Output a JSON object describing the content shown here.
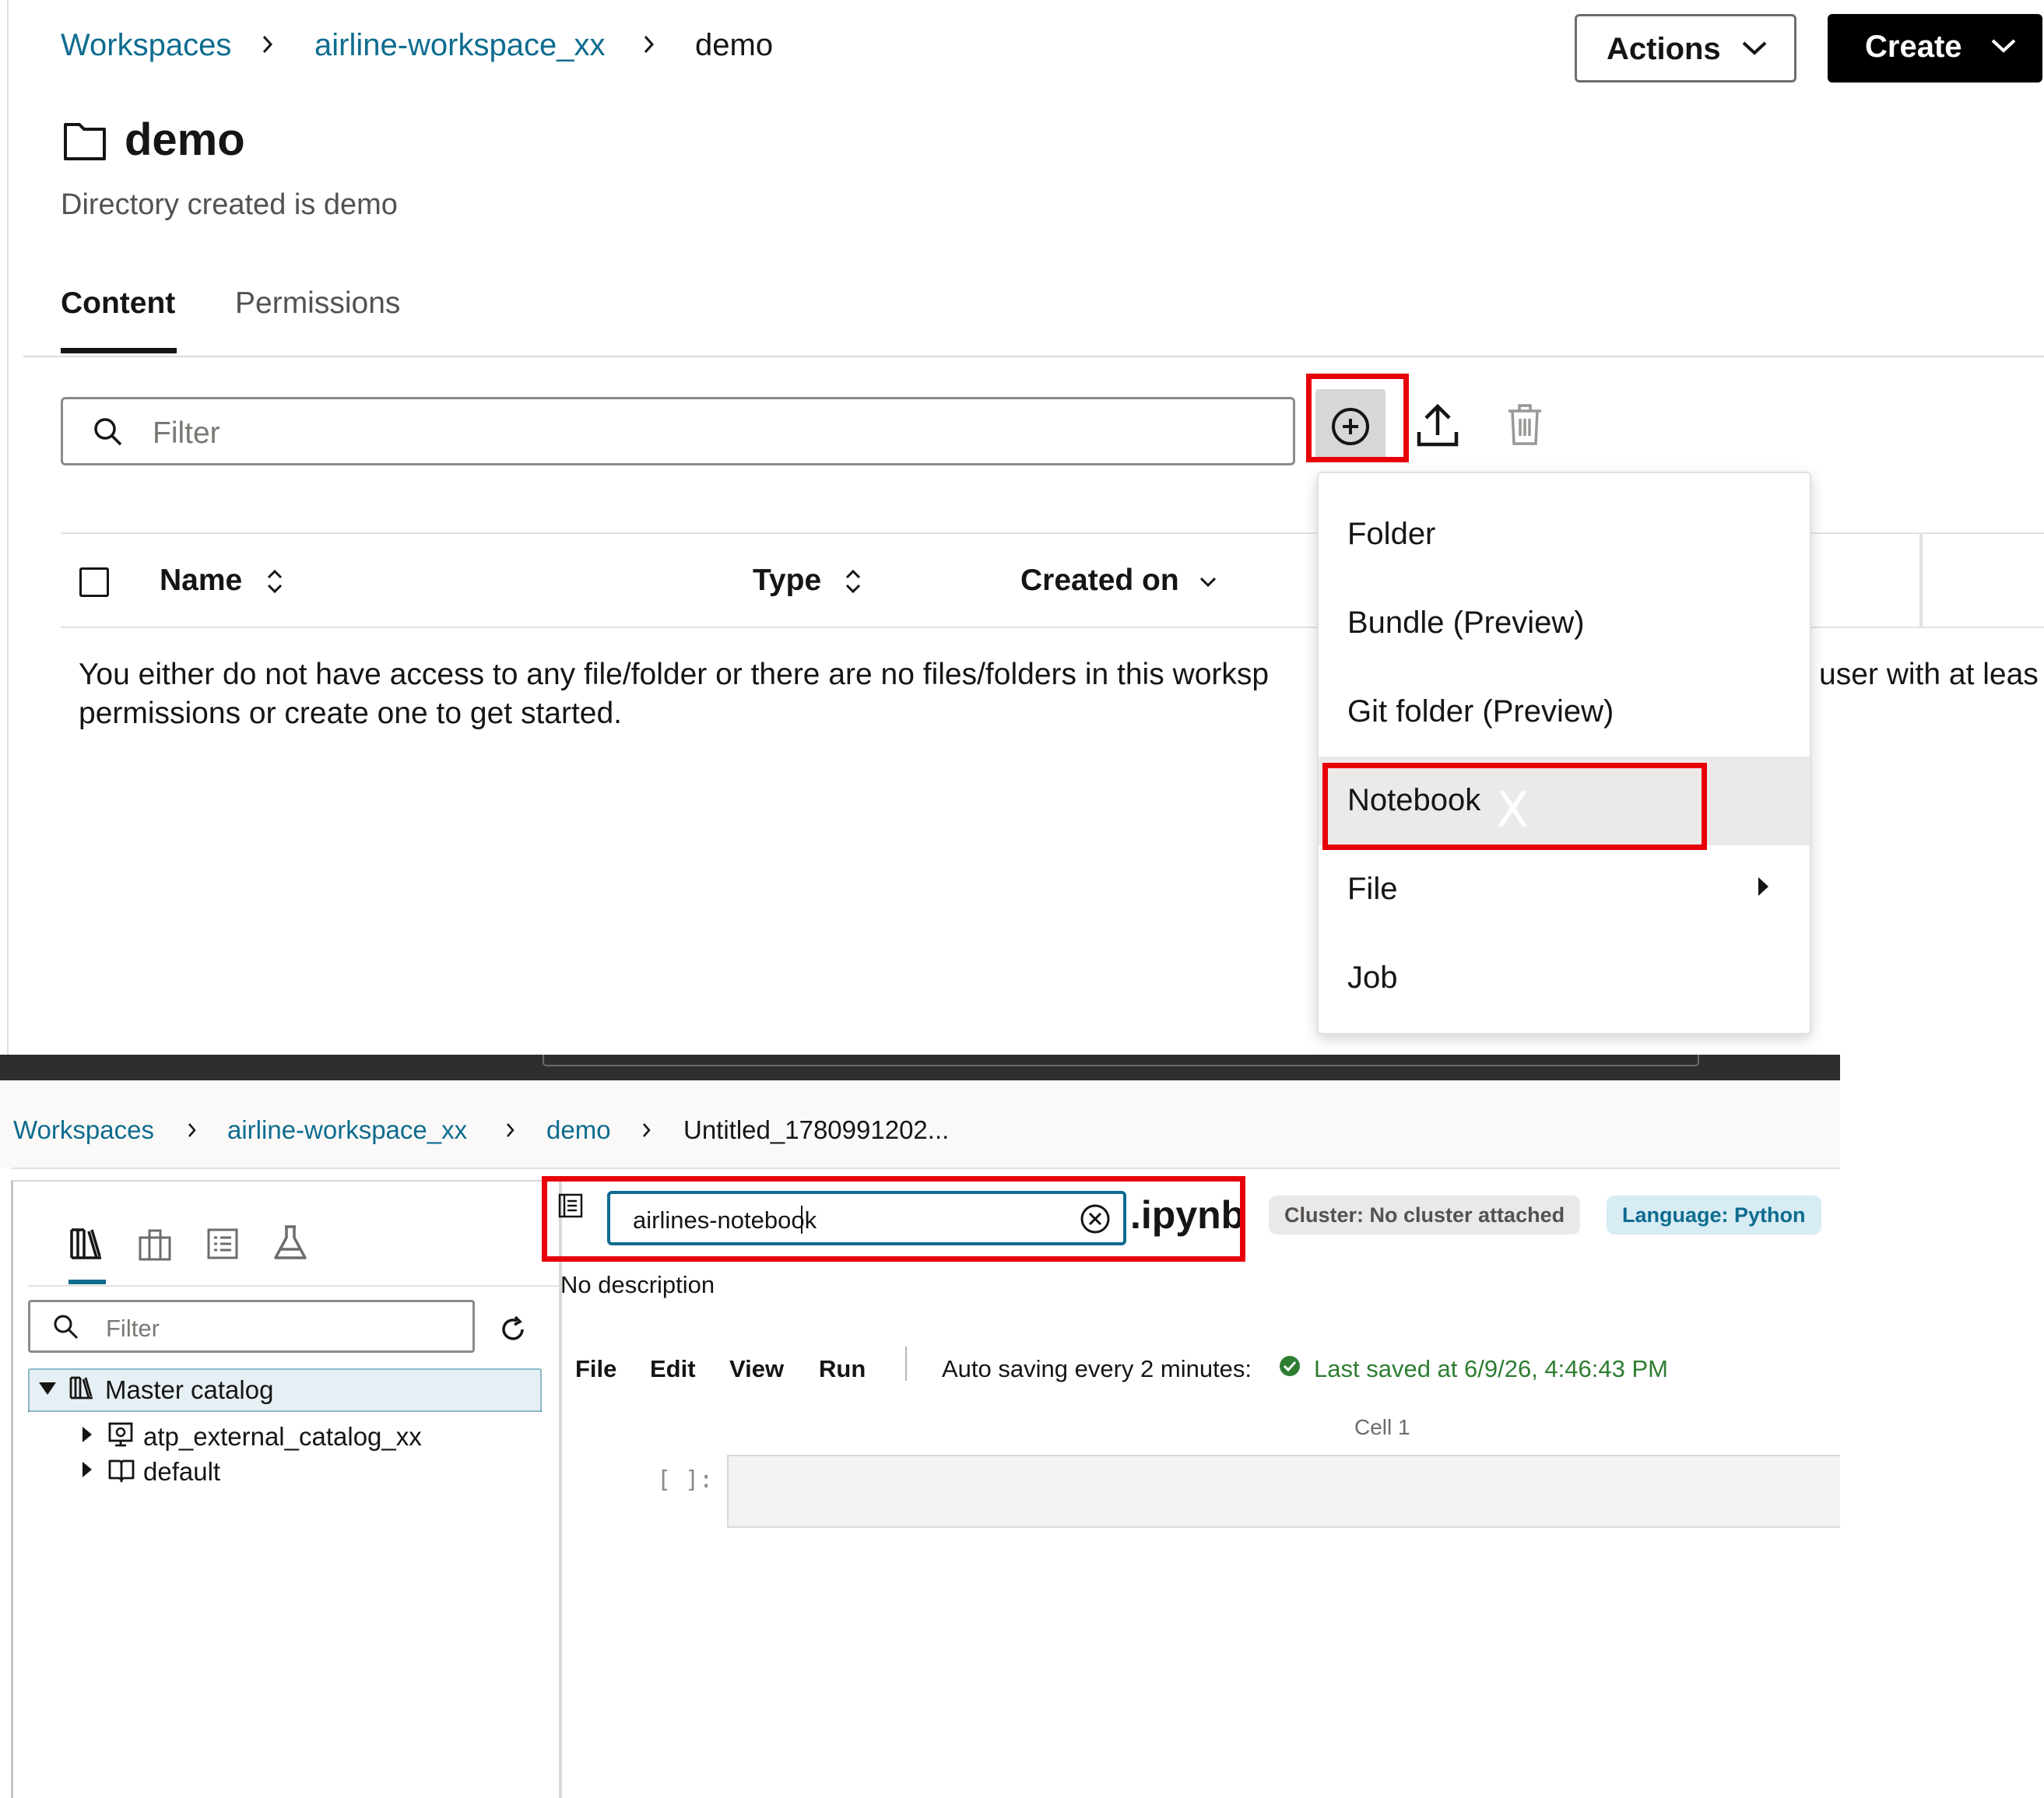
{
  "top": {
    "breadcrumb": [
      "Workspaces",
      "airline-workspace_xx",
      "demo"
    ],
    "actions_label": "Actions",
    "create_label": "Create",
    "title": "demo",
    "subtitle": "Directory created is demo",
    "tabs": [
      {
        "label": "Content",
        "active": true
      },
      {
        "label": "Permissions",
        "active": false
      }
    ],
    "filter_placeholder": "Filter",
    "toolbar_icons": [
      "create-icon",
      "upload-icon",
      "delete-icon"
    ],
    "table": {
      "columns": [
        {
          "label": "Name",
          "sort": "sortable"
        },
        {
          "label": "Type",
          "sort": "sortable"
        },
        {
          "label": "Created on",
          "sort": "descending"
        }
      ],
      "empty_line1": "You either do not have access to any file/folder or there are no files/folders in this worksp",
      "empty_line1_tail": "user with at leas",
      "empty_line2": "permissions or create one to get started."
    },
    "create_menu": {
      "items": [
        {
          "label": "Folder",
          "highlighted": false,
          "submenu": false
        },
        {
          "label": "Bundle (Preview)",
          "highlighted": false,
          "submenu": false
        },
        {
          "label": "Git folder (Preview)",
          "highlighted": false,
          "submenu": false
        },
        {
          "label": "Notebook",
          "highlighted": true,
          "submenu": false
        },
        {
          "label": "File",
          "highlighted": false,
          "submenu": true
        },
        {
          "label": "Job",
          "highlighted": false,
          "submenu": false
        }
      ]
    }
  },
  "bottom": {
    "breadcrumb": [
      "Workspaces",
      "airline-workspace_xx",
      "demo",
      "Untitled_1780991202..."
    ],
    "side_tabs": [
      "catalog-icon",
      "building-icon",
      "list-icon",
      "flask-icon"
    ],
    "filter_placeholder": "Filter",
    "tree": [
      {
        "label": "Master catalog",
        "expanded": true,
        "selected": true
      },
      {
        "label": "atp_external_catalog_xx",
        "expanded": false
      },
      {
        "label": "default",
        "expanded": false
      }
    ],
    "notebook": {
      "name_value": "airlines-notebook",
      "extension": ".ipynb",
      "cluster_badge": "Cluster: No cluster attached",
      "language_badge": "Language: Python",
      "description": "No description",
      "menu": [
        "File",
        "Edit",
        "View",
        "Run"
      ],
      "autosave": "Auto saving every 2 minutes:",
      "last_saved": "Last saved at 6/9/26, 4:46:43 PM",
      "cell_label": "Cell 1",
      "cell_prompt": "[ ]:"
    }
  },
  "colors": {
    "link": "#0e6c8f",
    "highlight_red": "#e8000b",
    "success_green": "#2e7d32",
    "primary_button": "#000000"
  }
}
